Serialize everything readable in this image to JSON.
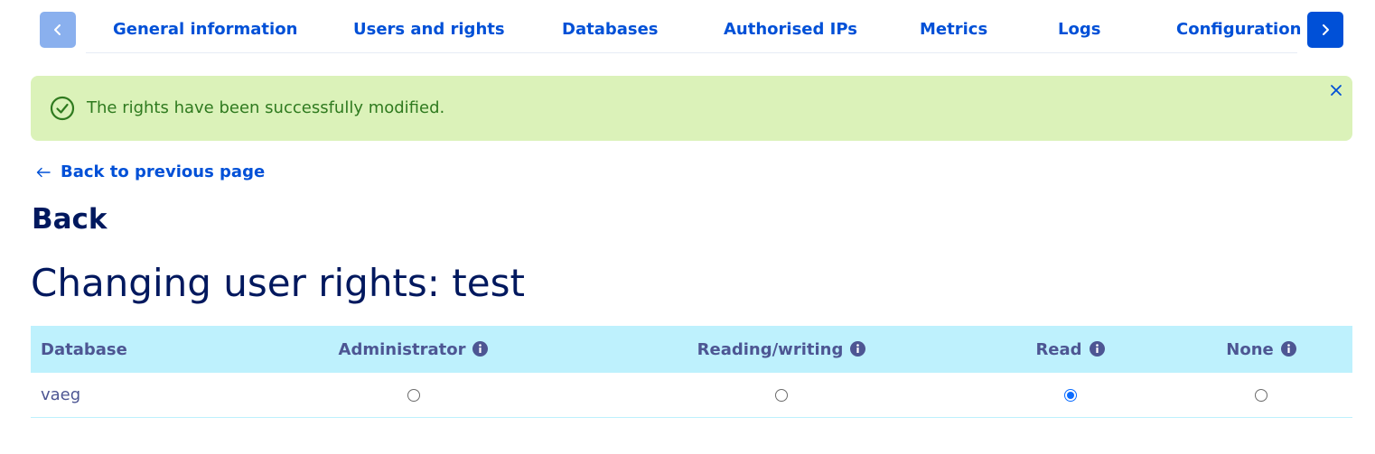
{
  "tabs": {
    "items": [
      {
        "label": "General information"
      },
      {
        "label": "Users and rights"
      },
      {
        "label": "Databases"
      },
      {
        "label": "Authorised IPs"
      },
      {
        "label": "Metrics"
      },
      {
        "label": "Logs"
      },
      {
        "label": "Configuration"
      }
    ],
    "prev_icon": "chevron-left-icon",
    "next_icon": "chevron-right-icon"
  },
  "banner": {
    "message": "The rights have been successfully modified.",
    "icon": "check-circle-icon",
    "close_icon": "close-icon",
    "color": "#dbf2b9"
  },
  "back_link": {
    "label": "Back to previous page",
    "icon": "arrow-left-icon"
  },
  "back_heading": "Back",
  "page_title": "Changing user rights: test",
  "table": {
    "columns": [
      {
        "label": "Database"
      },
      {
        "label": "Administrator",
        "icon": "info-icon"
      },
      {
        "label": "Reading/writing",
        "icon": "info-icon"
      },
      {
        "label": "Read",
        "icon": "info-icon"
      },
      {
        "label": "None",
        "icon": "info-icon"
      }
    ],
    "rows": [
      {
        "database": "vaeg",
        "selected": "Read"
      }
    ]
  },
  "colors": {
    "primary": "#0050d7",
    "heading": "#00185e",
    "table_header": "#bef1fd",
    "success_text": "#2f7a1f"
  }
}
